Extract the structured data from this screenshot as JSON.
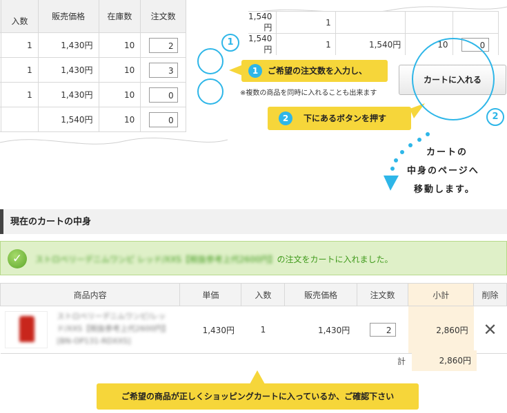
{
  "left_table": {
    "headers": [
      "入数",
      "販売価格",
      "在庫数",
      "注文数"
    ],
    "rows": [
      {
        "cut": "円",
        "qty": "1",
        "price": "1,430円",
        "stock": "10",
        "order": "2"
      },
      {
        "cut": "円",
        "qty": "1",
        "price": "1,430円",
        "stock": "10",
        "order": "3"
      },
      {
        "cut": "円",
        "qty": "1",
        "price": "1,430円",
        "stock": "10",
        "order": "0"
      },
      {
        "cut": "",
        "qty": "",
        "price": "1,540円",
        "stock": "10",
        "order": "0"
      }
    ]
  },
  "right_table": {
    "rows": [
      {
        "c1": "1,540円",
        "c2": "1",
        "c3": "",
        "c4": "",
        "c5": ""
      },
      {
        "c1": "1,540円",
        "c2": "1",
        "c3": "1,540円",
        "c4": "10",
        "c5": "0"
      }
    ]
  },
  "steps": {
    "one_number": "1",
    "one_text": "ご希望の注文数を入力し、",
    "one_note": "※複数の商品を同時に入れることも出来ます",
    "two_number": "2",
    "two_text": "下にあるボタンを押す"
  },
  "cart_button_label": "カートに入れる",
  "handwritten": [
    "カートの",
    "中身のページへ",
    "移動します。"
  ],
  "section_title": "現在のカートの中身",
  "notice": {
    "product": "ストロベリーデニムワンピ レッド/XXS【税抜参考上代2600円】",
    "message": "の注文をカートに入れました。"
  },
  "cart_table": {
    "headers": [
      "商品内容",
      "単価",
      "入数",
      "販売価格",
      "注文数",
      "小計",
      "削除"
    ],
    "row": {
      "name": "ストロベリーデニムワンピ/レッド/XXS【税抜参考上代2600円】 [BN-OP131-RDXXS]",
      "unit_price": "1,430円",
      "qty": "1",
      "price": "1,430円",
      "order": "2",
      "subtotal": "2,860円"
    },
    "total_label": "計",
    "total": "2,860円"
  },
  "bottom_callout": "ご希望の商品が正しくショッピングカートに入っているか、ご確認下さい",
  "colors": {
    "accent": "#2eb6e8",
    "callout": "#f6d63a",
    "notice_bg": "#dff0c8",
    "notice_text": "#3f9a1b",
    "subtotal_bg": "#fdf1dc"
  },
  "icons": [
    "check-icon",
    "delete-x-icon"
  ]
}
